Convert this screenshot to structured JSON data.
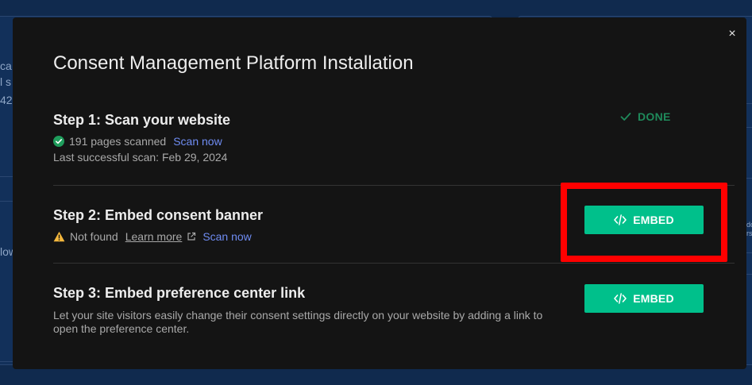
{
  "background": {
    "fragments": [
      "ca",
      "l s",
      "42",
      "low",
      "do",
      "rs",
      "-p"
    ]
  },
  "modal": {
    "title": "Consent Management Platform Installation",
    "close_label": "×",
    "step1": {
      "title": "Step 1: Scan your website",
      "pages_scanned": "191 pages scanned",
      "scan_link": "Scan now",
      "last_scan": "Last successful scan: Feb 29, 2024",
      "status": "DONE"
    },
    "step2": {
      "title": "Step 2: Embed consent banner",
      "status": "Not found",
      "learn_more": "Learn more",
      "scan_link": "Scan now",
      "button_label": "EMBED"
    },
    "step3": {
      "title": "Step 3: Embed preference center link",
      "description": "Let your site visitors easily change their consent settings directly on your website by adding a link to open the preference center.",
      "button_label": "EMBED"
    }
  },
  "colors": {
    "accent": "#00c08b",
    "link": "#6f8cf2",
    "done": "#1f8a5b",
    "warning": "#f5b83d",
    "highlight": "#ff0000"
  },
  "icons": {
    "close": "close-icon",
    "check_circle": "check-circle-icon",
    "check": "check-icon",
    "warning": "warning-icon",
    "external_link": "external-link-icon",
    "code": "code-icon"
  }
}
